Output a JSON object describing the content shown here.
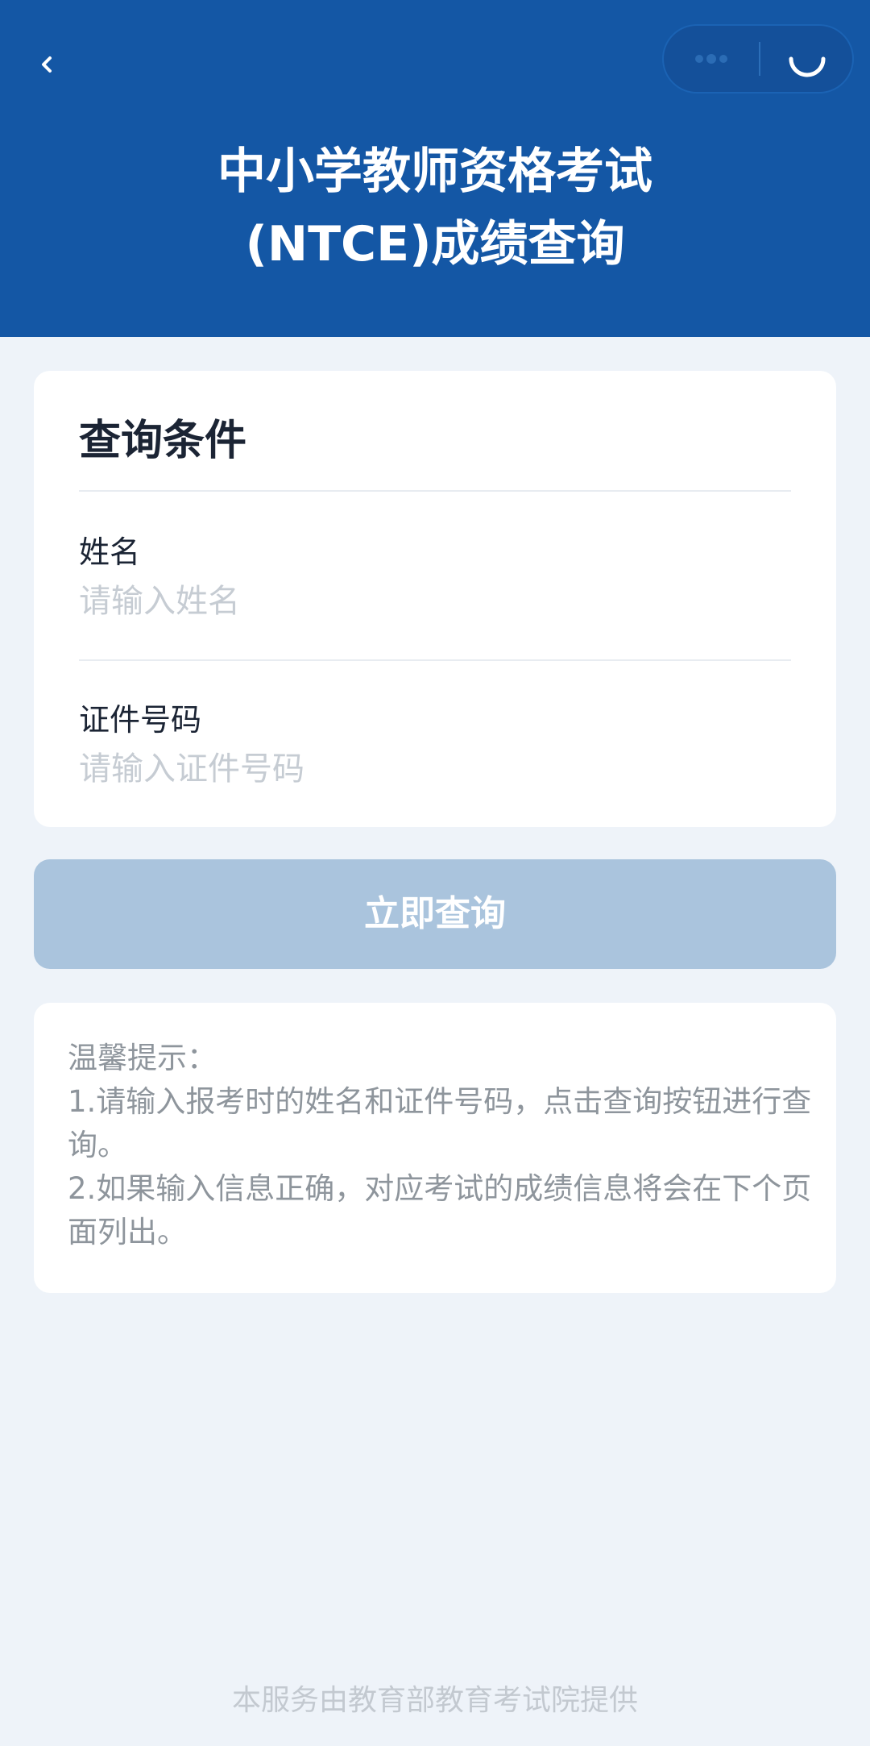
{
  "header": {
    "title_line1": "中小学教师资格考试",
    "title_line2": "(NTCE)成绩查询",
    "back_icon": "chevron-left-icon",
    "more_icon": "more-dots-icon",
    "close_icon": "close-circle-icon",
    "background_color": "#1457a5"
  },
  "form": {
    "section_title": "查询条件",
    "name_label": "姓名",
    "name_placeholder": "请输入姓名",
    "name_value": "",
    "id_label": "证件号码",
    "id_placeholder": "请输入证件号码",
    "id_value": ""
  },
  "submit": {
    "label": "立即查询",
    "color": "#aac4dd"
  },
  "tips": {
    "heading": "温馨提示：",
    "line1": "1.请输入报考时的姓名和证件号码，点击查询按钮进行查询。",
    "line2": "2.如果输入信息正确，对应考试的成绩信息将会在下个页面列出。"
  },
  "footer": {
    "text": "本服务由教育部教育考试院提供"
  }
}
